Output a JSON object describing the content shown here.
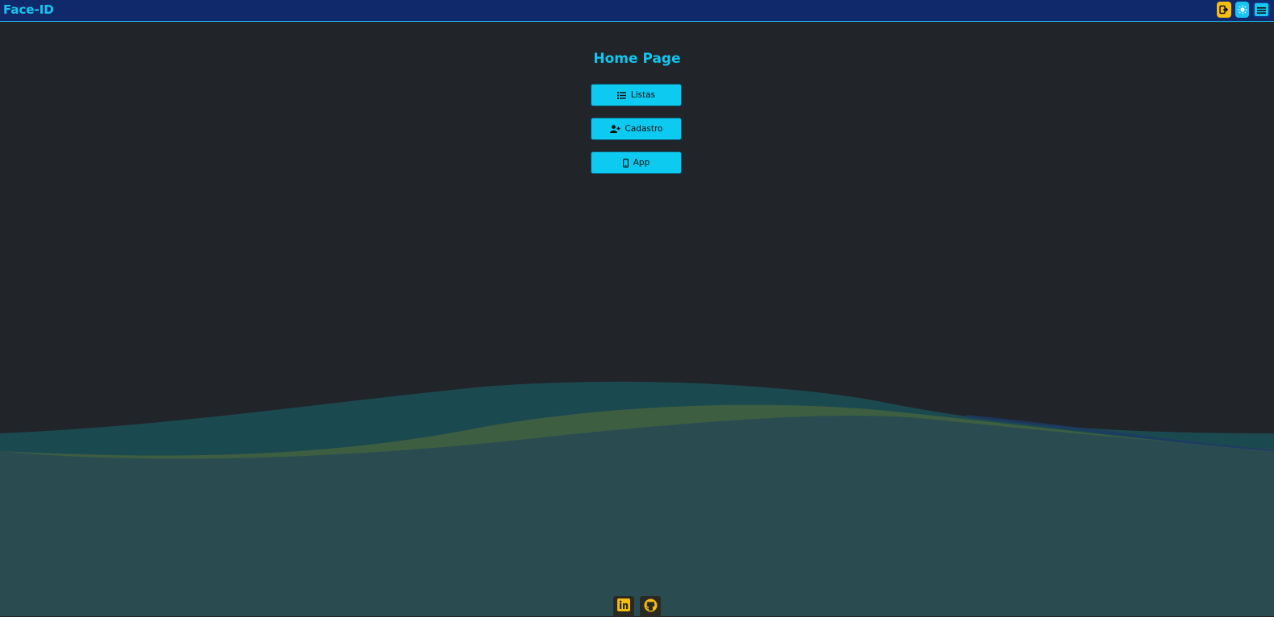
{
  "navbar": {
    "brand": "Face-ID",
    "icons": [
      "logout-icon",
      "theme-toggle-icon",
      "menu-icon"
    ]
  },
  "main": {
    "title": "Home Page",
    "buttons": [
      {
        "label": "Listas",
        "icon": "list-icon"
      },
      {
        "label": "Cadastro",
        "icon": "add-user-icon"
      },
      {
        "label": "App",
        "icon": "mobile-icon"
      }
    ]
  },
  "footer": {
    "links": [
      {
        "icon": "linkedin-icon"
      },
      {
        "icon": "github-icon"
      }
    ]
  },
  "colors": {
    "navbar": "#10296b",
    "accent": "#0dcaf0",
    "background": "#212429",
    "social_icon": "#f3bd13"
  }
}
